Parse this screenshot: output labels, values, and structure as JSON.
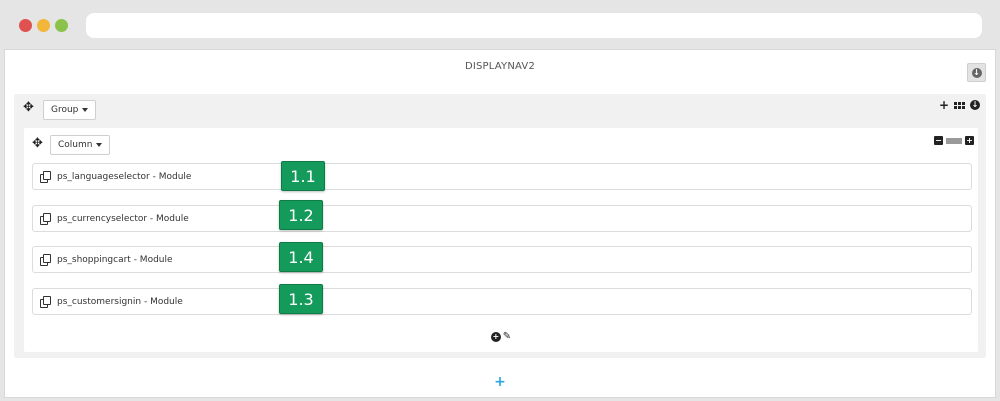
{
  "hook": {
    "title": "DISPLAYNAV2"
  },
  "group": {
    "dropdown_label": "Group"
  },
  "column": {
    "dropdown_label": "Column"
  },
  "modules": [
    {
      "label": "ps_languageselector - Module",
      "badge": "1.1"
    },
    {
      "label": "ps_currencyselector - Module",
      "badge": "1.2"
    },
    {
      "label": "ps_shoppingcart - Module",
      "badge": "1.4"
    },
    {
      "label": "ps_customersignin - Module",
      "badge": "1.3"
    }
  ],
  "icons": {
    "move": "move-icon",
    "add": "plus-icon",
    "grid": "grid-icon",
    "toggle": "toggle-circle-icon",
    "copy": "copy-icon",
    "pencil": "pencil-icon"
  },
  "colors": {
    "badge": "#149a5a",
    "add_group": "#2aa7e0"
  }
}
